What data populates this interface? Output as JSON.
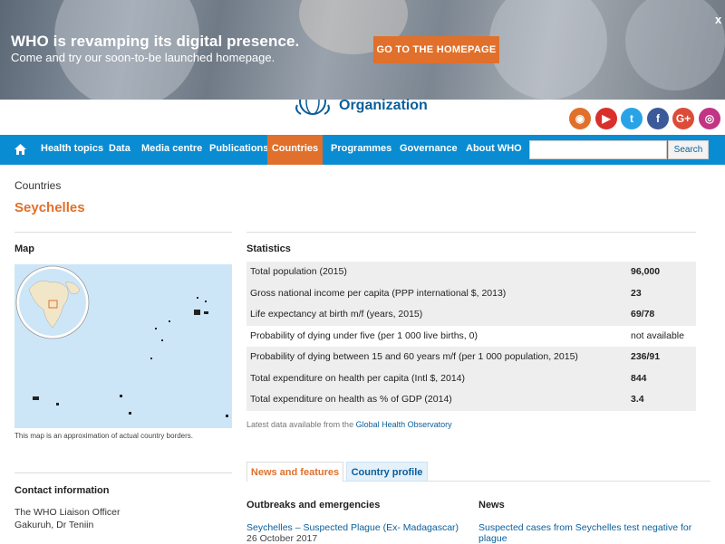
{
  "banner": {
    "headline": "WHO is revamping its digital presence.",
    "subline": "Come and try our soon-to-be launched homepage.",
    "cta": "GO TO THE HOMEPAGE",
    "close": "x"
  },
  "header": {
    "logo_text": "Organization"
  },
  "social": [
    {
      "icon": "rss-icon",
      "glyph": "◉",
      "color": "#e0702b"
    },
    {
      "icon": "youtube-icon",
      "glyph": "▶",
      "color": "#d9302b"
    },
    {
      "icon": "twitter-icon",
      "glyph": "t",
      "color": "#2aa3e6"
    },
    {
      "icon": "facebook-icon",
      "glyph": "f",
      "color": "#3b5a9a"
    },
    {
      "icon": "googleplus-icon",
      "glyph": "G+",
      "color": "#dd4b39"
    },
    {
      "icon": "instagram-icon",
      "glyph": "◎",
      "color": "#c13584"
    }
  ],
  "nav": {
    "items": [
      "Health topics",
      "Data",
      "Media centre",
      "Publications",
      "Countries",
      "Programmes",
      "Governance",
      "About WHO"
    ],
    "active": "Countries",
    "search_button": "Search",
    "search_value": ""
  },
  "breadcrumb": "Countries",
  "page_title": "Seychelles",
  "map": {
    "heading": "Map",
    "note": "This map is an approximation of actual country borders."
  },
  "stats": {
    "heading": "Statistics",
    "rows": [
      {
        "label": "Total population (2015)",
        "value": "96,000"
      },
      {
        "label": "Gross national income per capita (PPP international $, 2013)",
        "value": "23"
      },
      {
        "label": "Life expectancy at birth m/f (years, 2015)",
        "value": "69/78"
      },
      {
        "label": "Probability of dying under five (per 1 000 live births, 0)",
        "value": "not available"
      },
      {
        "label": "Probability of dying between 15 and 60 years m/f (per 1 000 population, 2015)",
        "value": "236/91"
      },
      {
        "label": "Total expenditure on health per capita (Intl $, 2014)",
        "value": "844"
      },
      {
        "label": "Total expenditure on health as % of GDP (2014)",
        "value": "3.4"
      }
    ],
    "latest_prefix": "Latest data available from the",
    "latest_link": "Global Health Observatory"
  },
  "tabs": [
    "News and features",
    "Country profile"
  ],
  "contact": {
    "heading": "Contact information",
    "line1": "The WHO Liaison Officer",
    "line2": "Gakuruh, Dr Teniin"
  },
  "outbreaks": {
    "heading": "Outbreaks and emergencies",
    "link": "Seychelles – Suspected Plague (Ex- Madagascar)",
    "date": "26 October 2017"
  },
  "news": {
    "heading": "News",
    "link_line1": "Suspected cases from Seychelles test negative for",
    "link_line2": "plague"
  },
  "colors": {
    "nav_blue": "#0a8cd2",
    "accent_orange": "#e0702b",
    "link_blue": "#0a5e9a"
  }
}
